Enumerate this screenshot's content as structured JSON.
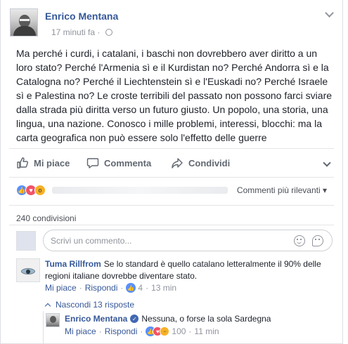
{
  "post": {
    "author": "Enrico Mentana",
    "time": "17 minuti fa",
    "separator": "·",
    "text": "Ma perché i curdi, i catalani, i baschi non dovrebbero aver diritto a un loro stato? Perché l'Armenia sì e il Kurdistan no? Perché Andorra sì e la Catalogna no? Perché il Liechtenstein sì e l'Euskadi no? Perché Israele sì e Palestina no? Le croste terribili del passato non possono farci sviare dalla strada più diritta verso un futuro giusto. Un popolo, una storia, una lingua, una nazione. Conosco i mille problemi, interessi, blocchi: ma la carta geografica non può essere solo l'effetto delle guerre"
  },
  "actions": {
    "like": "Mi piace",
    "comment": "Commenta",
    "share": "Condividi"
  },
  "reactions": {
    "filter_label": "Commenti più rilevanti ▾"
  },
  "shares": "240 condivisioni",
  "composer": {
    "placeholder": "Scrivi un commento..."
  },
  "comment": {
    "author": "Tuma Rillfrom",
    "text": "Se lo standard è quello catalano letteralmente il 90% delle regioni italiane dovrebbe diventare stato.",
    "like": "Mi piace",
    "reply": "Rispondi",
    "sep": "·",
    "reaction_count": "4",
    "time": "13 min"
  },
  "hide_replies": "Nascondi 13 risposte",
  "reply": {
    "author": "Enrico Mentana",
    "text": "Nessuna, o forse la sola Sardegna",
    "like": "Mi piace",
    "reply": "Rispondi",
    "sep": "·",
    "reaction_count": "100",
    "time": "11 min"
  },
  "colors": {
    "link": "#365899",
    "muted": "#90949c",
    "like": "#5890ff",
    "love": "#f25268",
    "wow": "#f7b125"
  }
}
